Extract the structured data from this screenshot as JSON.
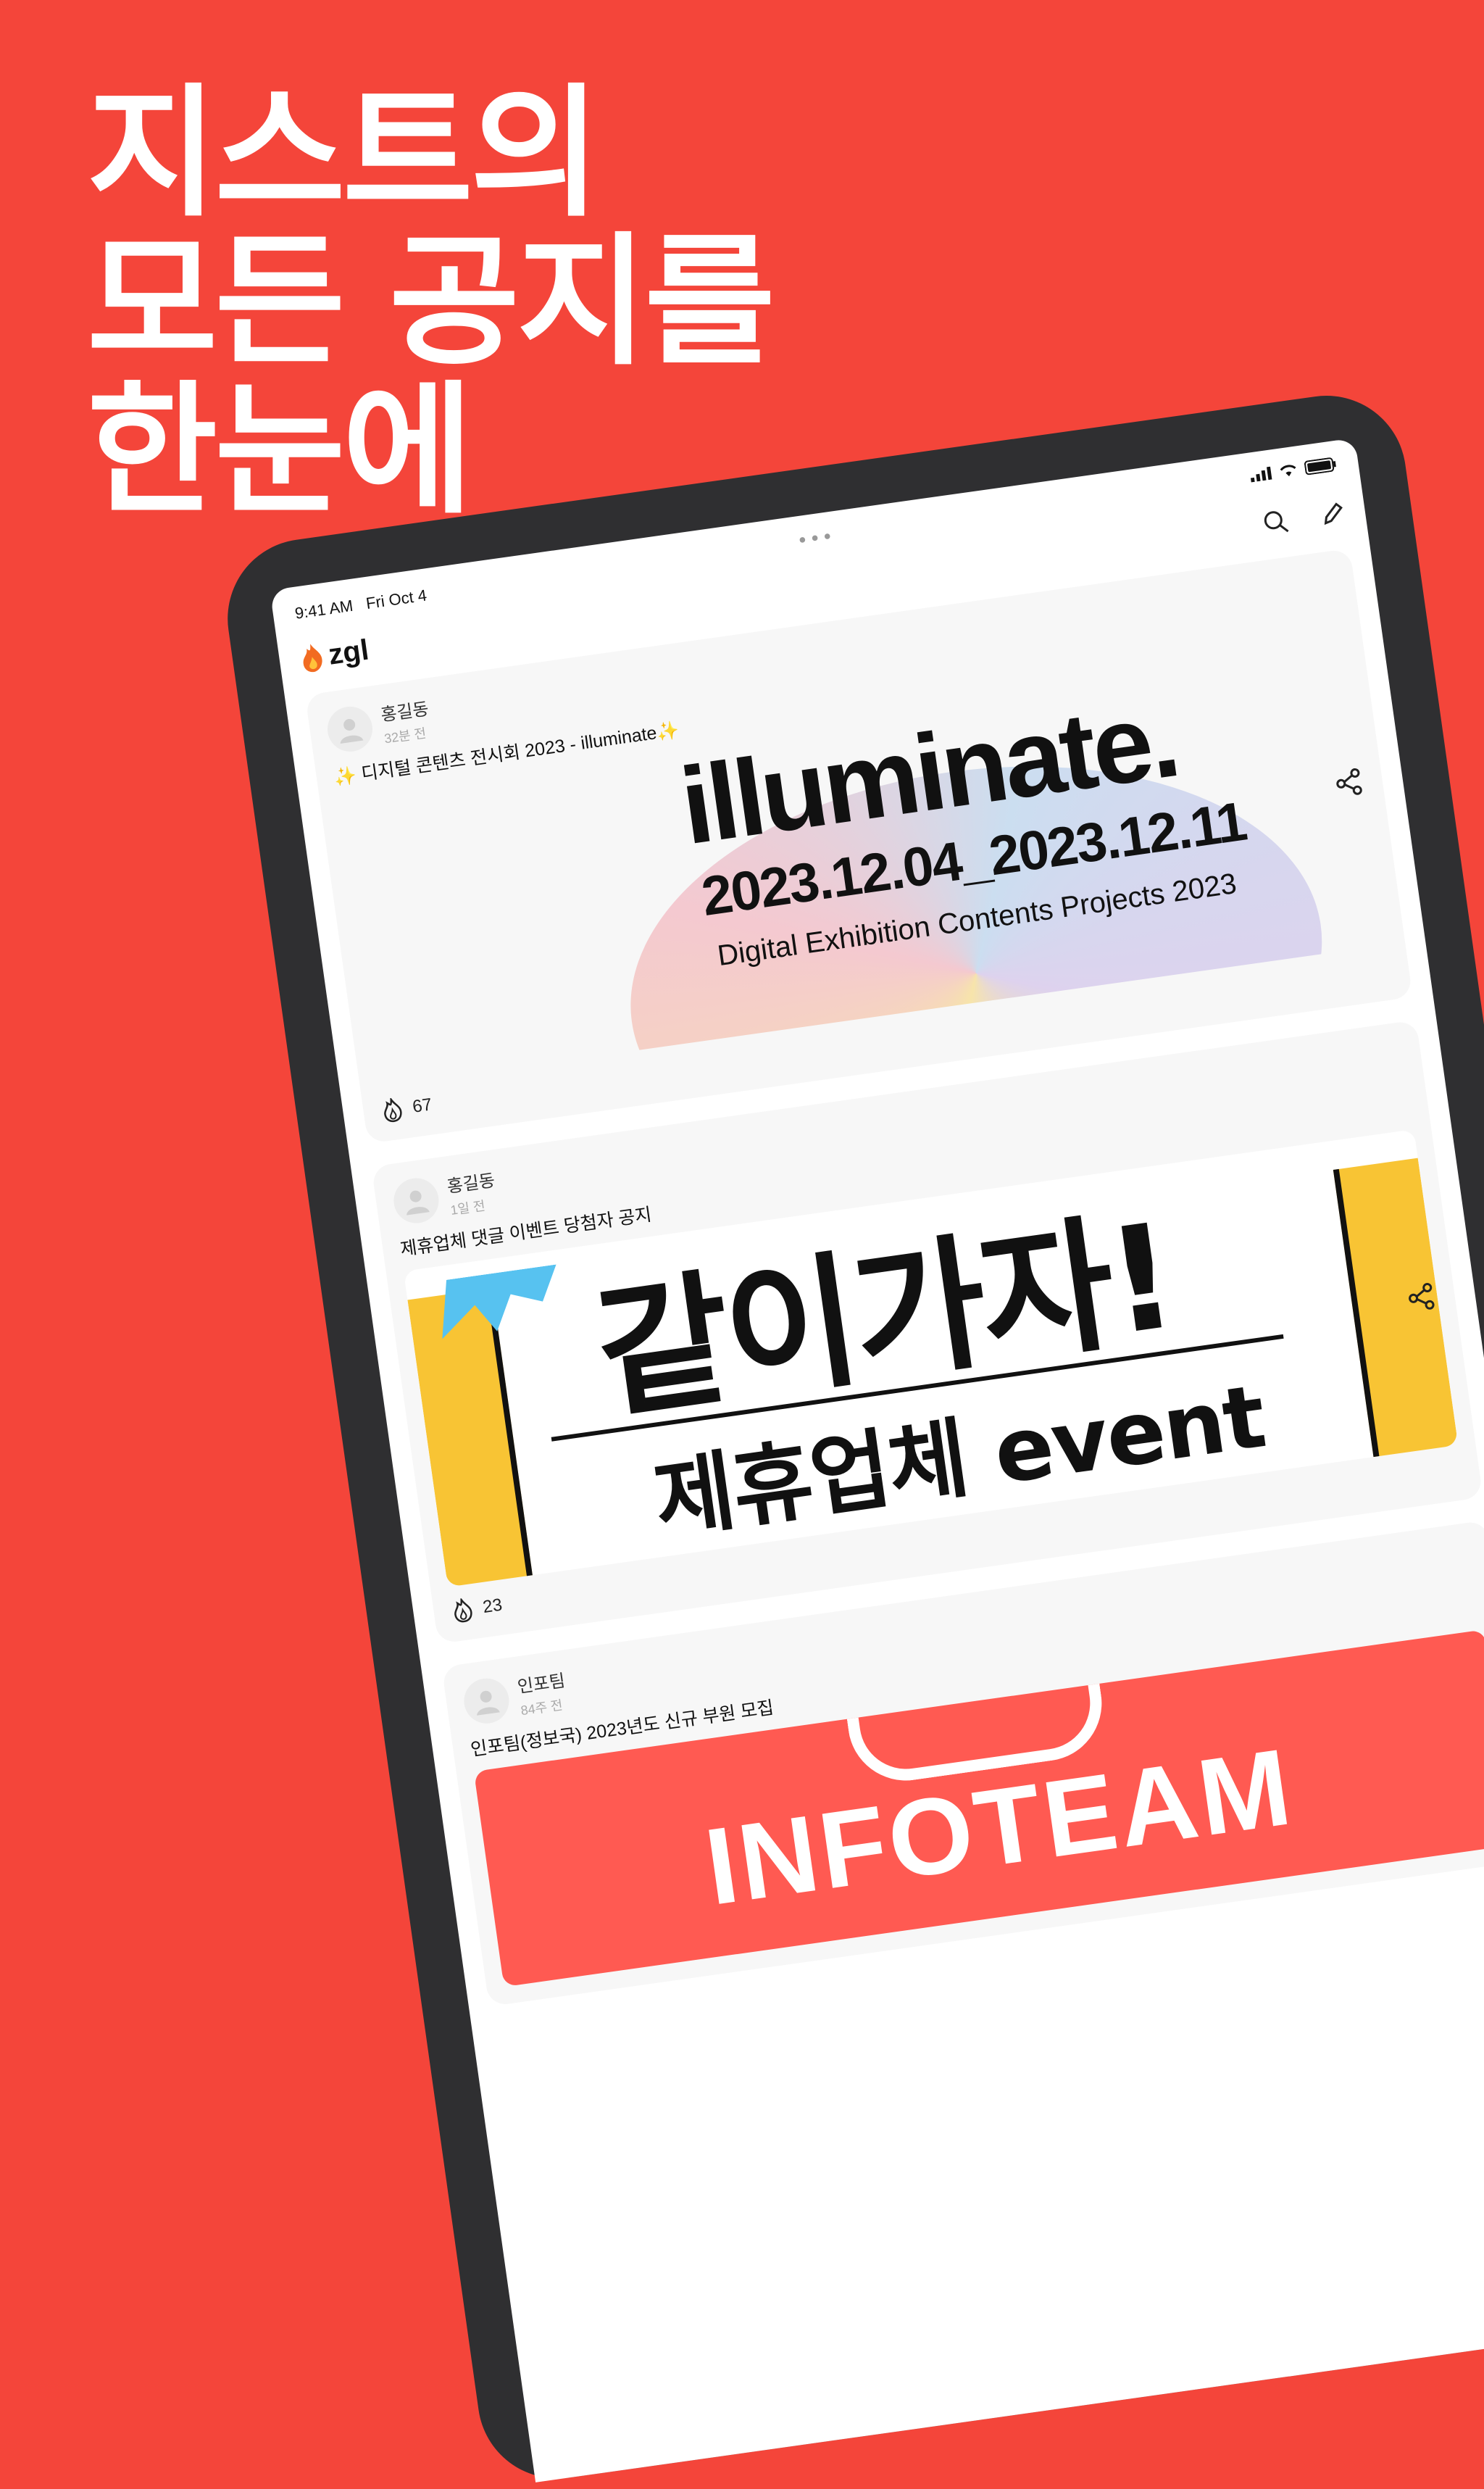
{
  "headline": {
    "line1": "지스트의",
    "line2": "모든 공지를",
    "line3": "한눈에"
  },
  "status": {
    "time": "9:41 AM",
    "date": "Fri Oct 4"
  },
  "app": {
    "name": "zgl",
    "logo_icon": "fire-icon",
    "search_icon": "search-icon",
    "compose_icon": "pencil-icon"
  },
  "posts": [
    {
      "author": "홍길동",
      "time": "32분 전",
      "title": "✨ 디지털 콘텐츠 전시회 2023 - illuminate✨",
      "poster": {
        "headline": "illuminate.",
        "dates": "2023.12.04_2023.12.11",
        "subtitle": "Digital Exhibition Contents Projects 2023"
      },
      "likes": "67"
    },
    {
      "author": "홍길동",
      "time": "1일 전",
      "title": "제휴업체 댓글 이벤트 당첨자 공지",
      "poster": {
        "headline": "같이가자!",
        "subtitle": "제휴업체 event"
      },
      "likes": "23"
    },
    {
      "author": "인포팀",
      "time": "84주 전",
      "title": "인포팀(정보국) 2023년도 신규 부원 모집",
      "poster": {
        "headline": "INFOTEAM"
      }
    }
  ],
  "colors": {
    "background": "#F4453A",
    "bezel": "#2F2F31",
    "card": "#F7F7F7",
    "accent_yellow": "#F8C434"
  }
}
